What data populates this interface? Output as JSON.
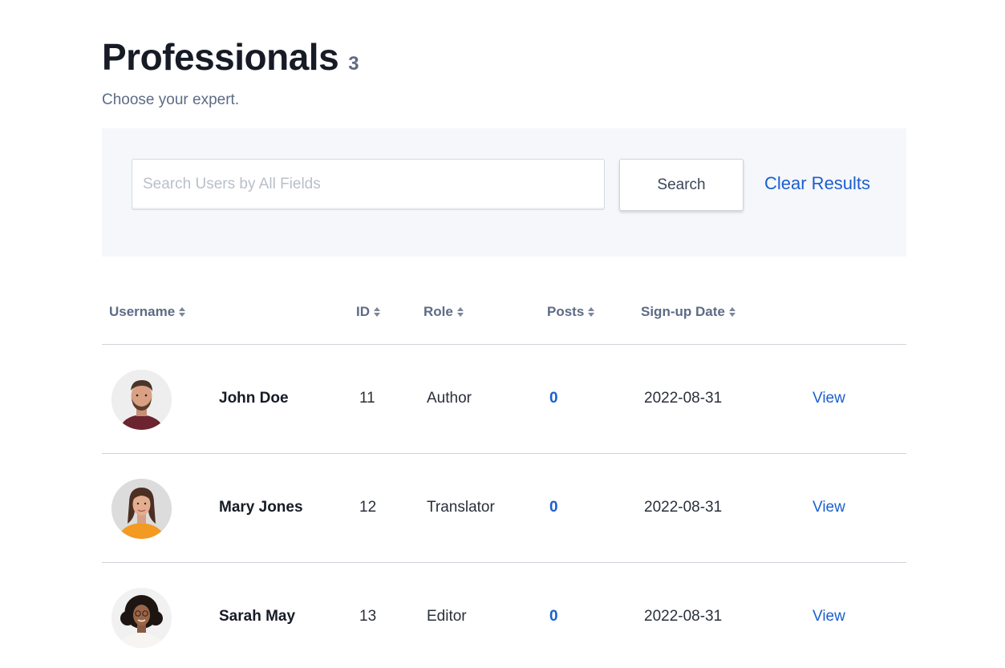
{
  "header": {
    "title": "Professionals",
    "count": "3",
    "subtitle": "Choose your expert."
  },
  "search": {
    "placeholder": "Search Users by All Fields",
    "value": "",
    "button_label": "Search",
    "clear_label": "Clear Results"
  },
  "table": {
    "columns": {
      "username": "Username",
      "id": "ID",
      "role": "Role",
      "posts": "Posts",
      "signup": "Sign-up Date"
    },
    "rows": [
      {
        "name": "John Doe",
        "id": "11",
        "role": "Author",
        "posts": "0",
        "date": "2022-08-31",
        "action": "View",
        "avatar": "avatar-man-beard"
      },
      {
        "name": "Mary Jones",
        "id": "12",
        "role": "Translator",
        "posts": "0",
        "date": "2022-08-31",
        "action": "View",
        "avatar": "avatar-woman-orange-top"
      },
      {
        "name": "Sarah May",
        "id": "13",
        "role": "Editor",
        "posts": "0",
        "date": "2022-08-31",
        "action": "View",
        "avatar": "avatar-woman-curly-hair"
      }
    ]
  },
  "colors": {
    "accent": "#1a5fd0",
    "muted_text": "#5d6b85",
    "panel_bg": "#f6f7fb",
    "divider": "#cfd3da"
  }
}
